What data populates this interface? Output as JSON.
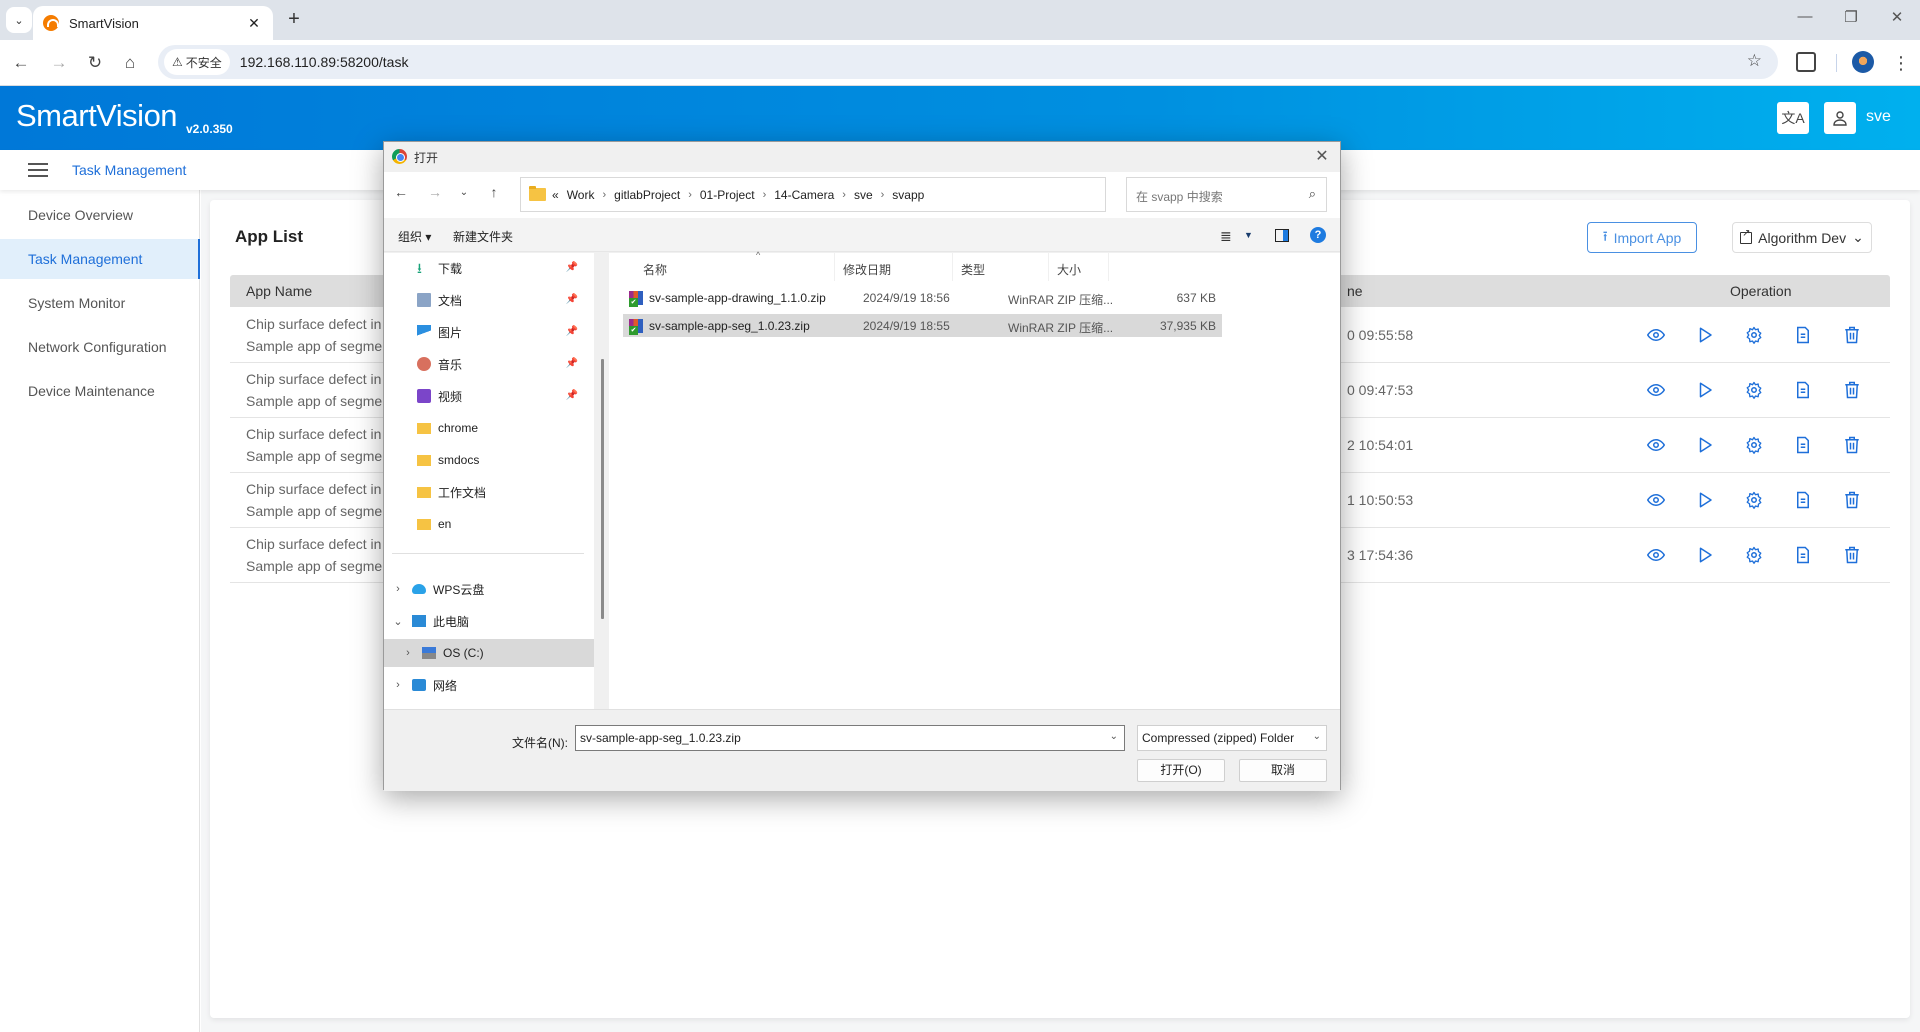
{
  "browser": {
    "tab_title": "SmartVision",
    "url": "192.168.110.89:58200/task",
    "security_label": "不安全"
  },
  "header": {
    "brand": "SmartVision",
    "version": "v2.0.350",
    "user": "sve"
  },
  "breadcrumb": "Task Management",
  "sidebar": {
    "items": [
      {
        "label": "Device Overview",
        "active": false
      },
      {
        "label": "Task Management",
        "active": true
      },
      {
        "label": "System Monitor",
        "active": false
      },
      {
        "label": "Network Configuration",
        "active": false
      },
      {
        "label": "Device Maintenance",
        "active": false
      }
    ]
  },
  "card": {
    "title": "App List",
    "import_label": "Import App",
    "algo_label": "Algorithm Dev",
    "columns": {
      "name": "App Name",
      "time_partial": "ne",
      "operation": "Operation"
    },
    "rows": [
      {
        "name": "Chip surface defect in",
        "desc": "Sample app of segme",
        "time": "0 09:55:58"
      },
      {
        "name": "Chip surface defect in",
        "desc": "Sample app of segme",
        "time": "0 09:47:53"
      },
      {
        "name": "Chip surface defect in",
        "desc": "Sample app of segme",
        "time": "2 10:54:01"
      },
      {
        "name": "Chip surface defect in",
        "desc": "Sample app of segme",
        "time": "1 10:50:53"
      },
      {
        "name": "Chip surface defect in",
        "desc": "Sample app of segme",
        "time": "3 17:54:36"
      }
    ]
  },
  "dialog": {
    "title": "打开",
    "path": [
      "Work",
      "gitlabProject",
      "01-Project",
      "14-Camera",
      "sve",
      "svapp"
    ],
    "path_prefix": "«",
    "search_placeholder": "在 svapp 中搜索",
    "toolbar": {
      "organize": "组织 ▾",
      "new_folder": "新建文件夹"
    },
    "nav": {
      "quick": [
        {
          "label": "下载",
          "icon": "download-icon",
          "pinned": true
        },
        {
          "label": "文档",
          "icon": "document-icon",
          "pinned": true
        },
        {
          "label": "图片",
          "icon": "picture-icon",
          "pinned": true
        },
        {
          "label": "音乐",
          "icon": "music-icon",
          "pinned": true
        },
        {
          "label": "视频",
          "icon": "video-icon",
          "pinned": true
        },
        {
          "label": "chrome",
          "icon": "folder-icon",
          "pinned": false
        },
        {
          "label": "smdocs",
          "icon": "folder-icon",
          "pinned": false
        },
        {
          "label": "工作文档",
          "icon": "folder-icon",
          "pinned": false
        },
        {
          "label": "en",
          "icon": "folder-icon",
          "pinned": false
        }
      ],
      "tree": [
        {
          "label": "WPS云盘",
          "icon": "cloud-icon",
          "expander": "›"
        },
        {
          "label": "此电脑",
          "icon": "computer-icon",
          "expander": "⌄"
        },
        {
          "label": "OS (C:)",
          "icon": "drive-icon",
          "expander": "›",
          "selected": true
        },
        {
          "label": "网络",
          "icon": "network-icon",
          "expander": "›"
        }
      ]
    },
    "columns": {
      "name": "名称",
      "date": "修改日期",
      "type": "类型",
      "size": "大小"
    },
    "files": [
      {
        "name": "sv-sample-app-drawing_1.1.0.zip",
        "date": "2024/9/19 18:56",
        "type": "WinRAR ZIP 压缩...",
        "size": "637 KB",
        "selected": false
      },
      {
        "name": "sv-sample-app-seg_1.0.23.zip",
        "date": "2024/9/19 18:55",
        "type": "WinRAR ZIP 压缩...",
        "size": "37,935 KB",
        "selected": true
      }
    ],
    "filename_label": "文件名(N):",
    "filename_value": "sv-sample-app-seg_1.0.23.zip",
    "filetype_value": "Compressed (zipped) Folder",
    "open_label": "打开(O)",
    "cancel_label": "取消"
  },
  "colors": {
    "brand_blue": "#0078d8",
    "accent": "#1e6fd9",
    "active_bg": "#e1effb"
  }
}
